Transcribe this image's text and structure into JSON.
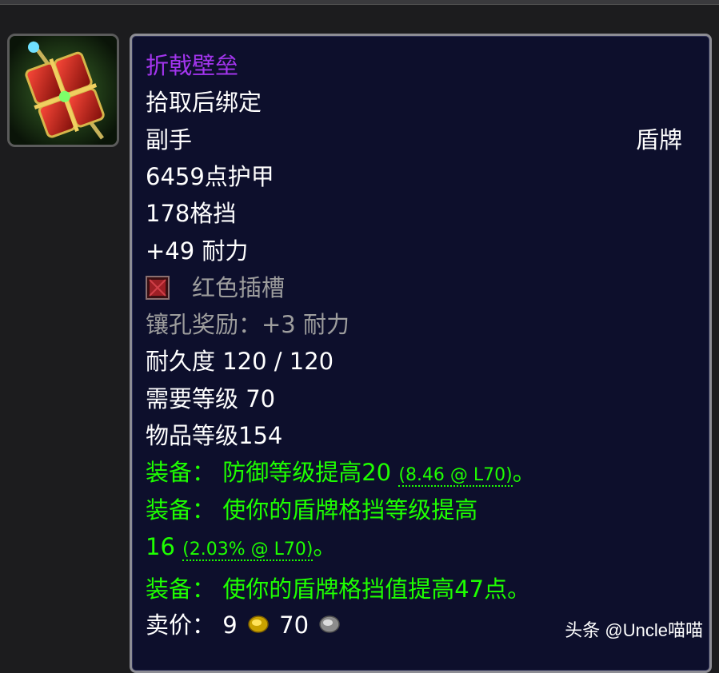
{
  "item": {
    "name": "折戟壁垒",
    "binding": "拾取后绑定",
    "slot": "副手",
    "type": "盾牌",
    "armor": "6459点护甲",
    "block": "178格挡",
    "stamina": "+49 耐力",
    "socket": "红色插槽",
    "socket_bonus": "镶孔奖励：+3 耐力",
    "durability": "耐久度 120 / 120",
    "required_level": "需要等级 70",
    "item_level": "物品等级154",
    "equip_1_label": "装备：",
    "equip_1_text": "防御等级提高20",
    "equip_1_detail": "(8.46 @ L70)",
    "equip_1_end": "。",
    "equip_2_label": "装备：",
    "equip_2_text": "使你的盾牌格挡等级提高",
    "equip_2_value": "16",
    "equip_2_detail": "(2.03% @ L70)",
    "equip_2_end": "。",
    "equip_3_label": "装备：",
    "equip_3_text": "使你的盾牌格挡值提高47点。",
    "sell_label": "卖价：",
    "sell_gold": "9",
    "sell_silver": "70"
  },
  "watermark": "头条 @Uncle喵喵",
  "colors": {
    "epic": "#a335ee",
    "uncommon": "#1eff00",
    "grey": "#9d9d9d",
    "tooltip_bg": "#0d0f2c"
  },
  "icons": [
    "shield-item-icon",
    "red-socket-icon",
    "gold-coin-icon",
    "silver-coin-icon"
  ]
}
